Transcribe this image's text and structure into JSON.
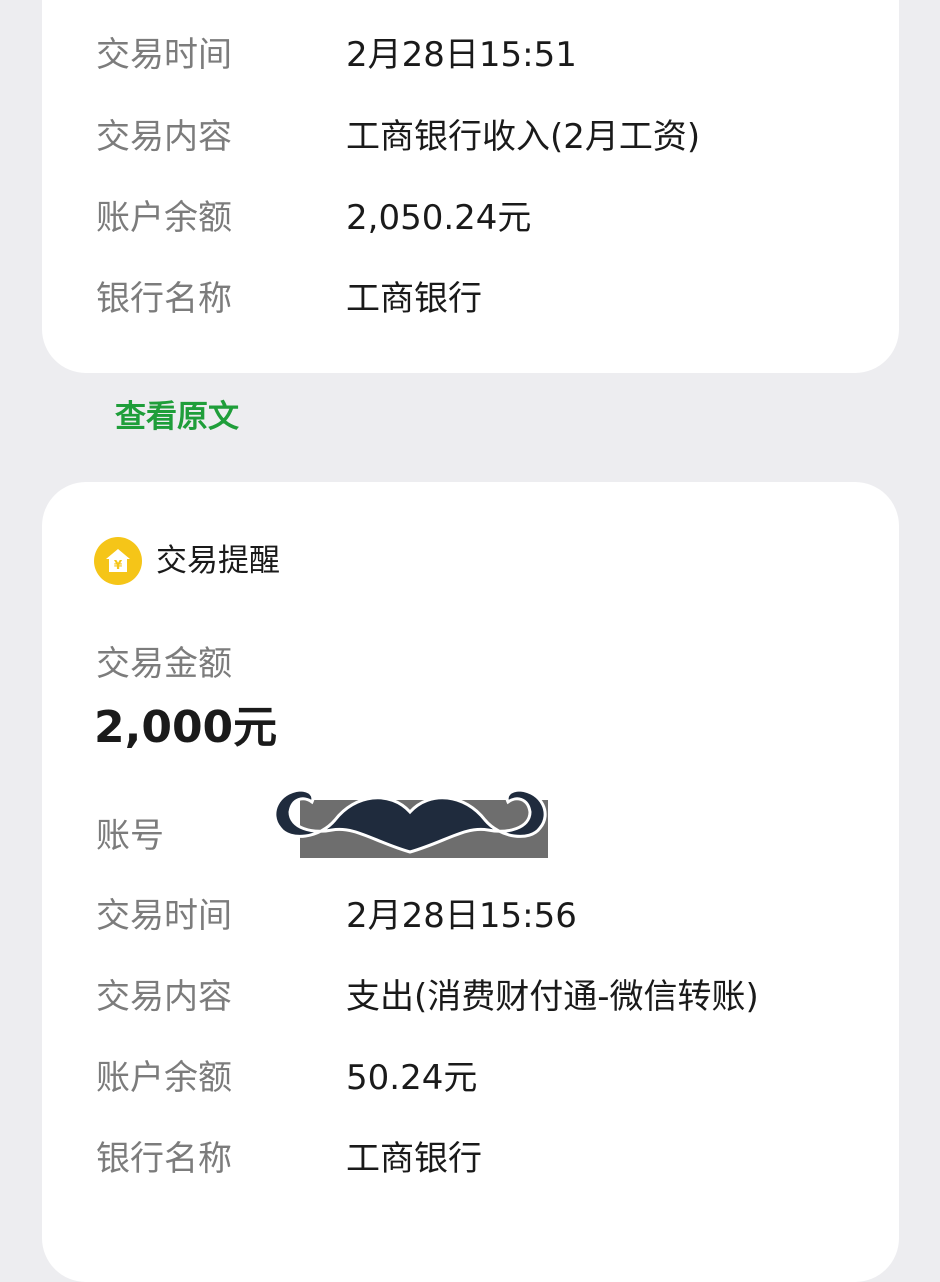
{
  "top_card": {
    "rows": [
      {
        "label": "交易时间",
        "value": "2月28日15:51"
      },
      {
        "label": "交易内容",
        "value": "工商银行收入(2月工资)"
      },
      {
        "label": "账户余额",
        "value": "2,050.24元"
      },
      {
        "label": "银行名称",
        "value": "工商银行"
      }
    ]
  },
  "view_original_label": "查看原文",
  "bottom_card": {
    "title": "交易提醒",
    "icon": "bank-yuan-icon",
    "icon_color": "#f5c518",
    "amount_label": "交易金额",
    "amount_value": "2,000元",
    "account_label": "账号",
    "rows": [
      {
        "label": "交易时间",
        "value": "2月28日15:56"
      },
      {
        "label": "交易内容",
        "value": "支出(消费财付通-微信转账)"
      },
      {
        "label": "账户余额",
        "value": "50.24元"
      },
      {
        "label": "银行名称",
        "value": "工商银行"
      }
    ]
  },
  "colors": {
    "background": "#ededf0",
    "card": "#ffffff",
    "label": "#7c7c7c",
    "value": "#1a1a1a",
    "link_green": "#1f9e3a",
    "mustache": "#1f2b3d",
    "redaction_bar": "#6e6e6e"
  }
}
